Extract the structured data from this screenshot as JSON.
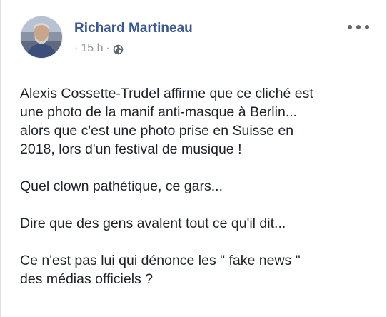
{
  "post": {
    "author": "Richard Martineau",
    "separator": "·",
    "timestamp": "15 h",
    "privacy_icon": "globe-icon",
    "more_icon": "more-options-icon",
    "paragraphs": [
      {
        "lines": [
          "Alexis Cossette-Trudel affirme que ce cliché est",
          "une photo de la manif anti-masque à Berlin...",
          "alors que c'est une photo prise en Suisse en",
          "2018, lors d'un festival de musique !"
        ]
      },
      {
        "lines": [
          "Quel clown pathétique, ce gars..."
        ]
      },
      {
        "lines": [
          "Dire que des gens avalent tout ce qu'il dit..."
        ]
      },
      {
        "lines": [
          "Ce n'est pas lui qui dénonce les \" fake news \"",
          "des médias officiels ?"
        ]
      }
    ]
  },
  "colors": {
    "author_link": "#385898",
    "meta_text": "#90949c",
    "body_text": "#1d2129"
  }
}
